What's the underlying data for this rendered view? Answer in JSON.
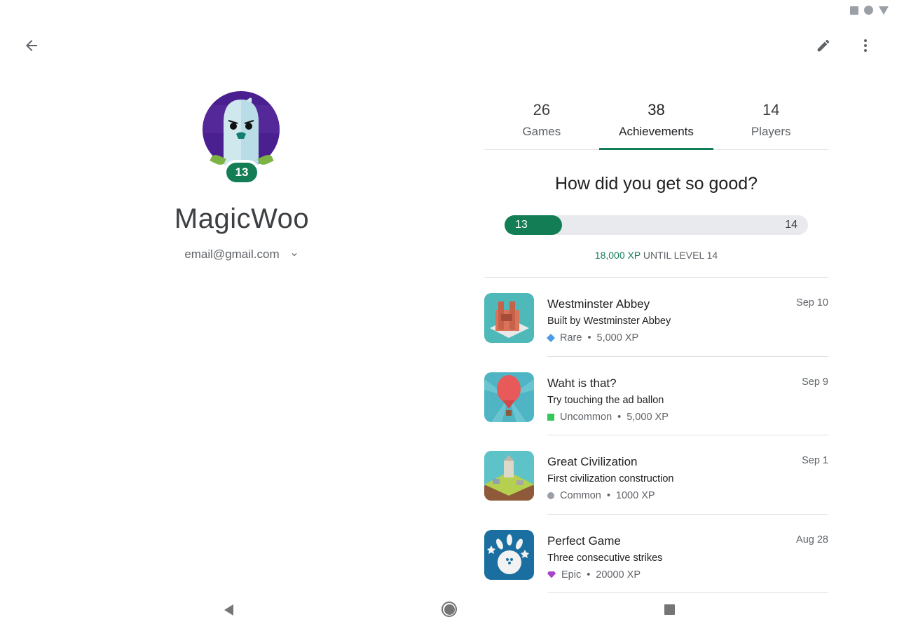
{
  "status_bar": {
    "icons": [
      "square-icon",
      "circle-icon",
      "triangle-icon"
    ]
  },
  "toolbar": {
    "back_icon": "arrow-back-icon",
    "edit_icon": "pencil-icon",
    "more_icon": "more-vert-icon"
  },
  "profile": {
    "avatar": "ghost-avatar",
    "level": "13",
    "username": "MagicWoo",
    "email": "email@gmail.com"
  },
  "tabs": [
    {
      "count": "26",
      "label": "Games",
      "active": false
    },
    {
      "count": "38",
      "label": "Achievements",
      "active": true
    },
    {
      "count": "14",
      "label": "Players",
      "active": false
    }
  ],
  "progress": {
    "headline": "How did you get so good?",
    "current_level": "13",
    "next_level": "14",
    "fraction": 0.19,
    "xp_amount": "18,000 XP",
    "xp_suffix": " UNTIL LEVEL 14"
  },
  "achievements": [
    {
      "title": "Westminster Abbey",
      "description": "Built by Westminster Abbey",
      "rarity": "Rare",
      "rarity_key": "rare",
      "xp": "5,000 XP",
      "date": "Sep 10",
      "thumb": "westminster-abbey"
    },
    {
      "title": "Waht is that?",
      "description": "Try touching the ad ballon",
      "rarity": "Uncommon",
      "rarity_key": "uncommon",
      "xp": "5,000 XP",
      "date": "Sep 9",
      "thumb": "hot-air-balloon"
    },
    {
      "title": "Great Civilization",
      "description": "First civilization construction",
      "rarity": "Common",
      "rarity_key": "common",
      "xp": "1000 XP",
      "date": "Sep 1",
      "thumb": "civilization"
    },
    {
      "title": "Perfect Game",
      "description": "Three consecutive strikes",
      "rarity": "Epic",
      "rarity_key": "epic",
      "xp": "20000 XP",
      "date": "Aug 28",
      "thumb": "bowling"
    }
  ],
  "nav_bar": {
    "back": "nav-back-icon",
    "home": "nav-home-icon",
    "recents": "nav-recents-icon"
  },
  "colors": {
    "accent": "#137e56",
    "rare": "#4a9ce8",
    "uncommon": "#34c759",
    "common": "#9aa0a6",
    "epic": "#a743c9"
  }
}
